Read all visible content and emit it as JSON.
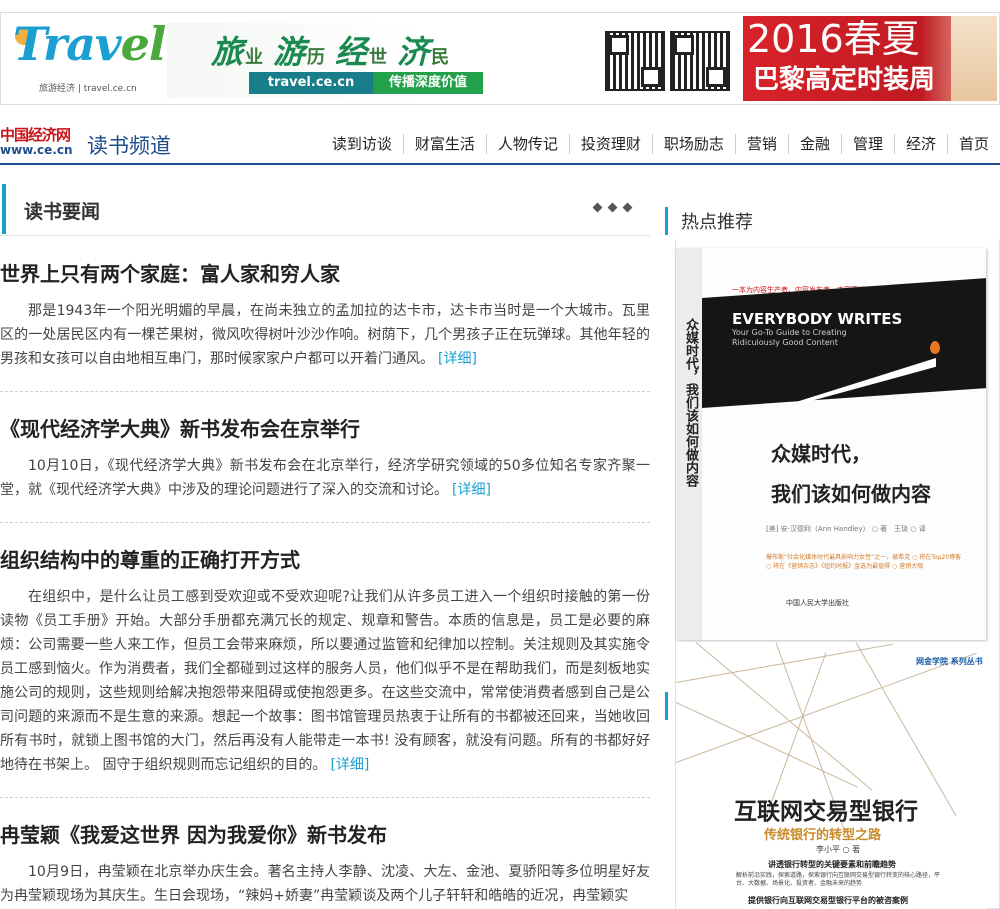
{
  "banner": {
    "logo_word_a": "Trav",
    "logo_word_b": "el",
    "logo_sub": "旅游经济 | travel.ce.cn",
    "slogan": [
      {
        "big": "旅",
        "small": "业"
      },
      {
        "big": "游",
        "small": "历"
      },
      {
        "big": "经",
        "small": "世"
      },
      {
        "big": "济",
        "small": "民"
      }
    ],
    "url": "travel.ce.cn",
    "tagline": "传播深度价值",
    "ad_line1": "2016春夏",
    "ad_line2": "巴黎高定时装周"
  },
  "channel": {
    "brand_cn_a": "中国",
    "brand_cn_b": "经济网",
    "brand_domain": "www.ce.cn",
    "name": "读书频道",
    "nav": [
      "读到访谈",
      "财富生活",
      "人物传记",
      "投资理财",
      "职场励志",
      "营销",
      "金融",
      "管理",
      "经济",
      "首页"
    ]
  },
  "section": {
    "title": "读书要闻"
  },
  "articles": [
    {
      "title": "世界上只有两个家庭：富人家和穷人家",
      "body": "那是1943年一个阳光明媚的早晨，在尚未独立的孟加拉的达卡市，达卡市当时是一个大城市。瓦里区的一处居民区内有一棵芒果树，微风吹得树叶沙沙作响。树荫下，几个男孩子正在玩弹球。其他年轻的男孩和女孩可以自由地相互串门，那时候家家户户都可以开着门通风。",
      "more": "[详细]"
    },
    {
      "title": "《现代经济学大典》新书发布会在京举行",
      "body": "10月10日，《现代经济学大典》新书发布会在北京举行，经济学研究领域的50多位知名专家齐聚一堂，就《现代经济学大典》中涉及的理论问题进行了深入的交流和讨论。",
      "more": "[详细]"
    },
    {
      "title": "组织结构中的尊重的正确打开方式",
      "body": "在组织中，是什么让员工感到受欢迎或不受欢迎呢?让我们从许多员工进入一个组织时接触的第一份读物《员工手册》开始。大部分手册都充满冗长的规定、规章和警告。本质的信息是，员工是必要的麻烦：公司需要一些人来工作，但员工会带来麻烦，所以要通过监管和纪律加以控制。关注规则及其实施令员工感到恼火。作为消费者，我们全都碰到过这样的服务人员，他们似乎不是在帮助我们，而是刻板地实施公司的规则，这些规则给解决抱怨带来阻碍或使抱怨更多。在这些交流中，常常使消费者感到自己是公司问题的来源而不是生意的来源。想起一个故事：图书馆管理员热衷于让所有的书都被还回来，当她收回所有书时，就锁上图书馆的大门，然后再没有人能带走一本书! 没有顾客，就没有问题。所有的书都好好地待在书架上。 固守于组织规则而忘记组织的目的。",
      "more": "[详细]"
    },
    {
      "title": "冉莹颖《我爱这世界 因为我爱你》新书发布",
      "body": "10月9日，冉莹颖在北京举办庆生会。著名主持人李静、沈凌、大左、金池、夏骄阳等多位明星好友为冉莹颖现场为其庆生。生日会现场，“辣妈+娇妻”冉莹颖谈及两个儿子轩轩和皓皓的近况，冉莹颖实",
      "more": ""
    }
  ],
  "sidebar": {
    "title": "热点推荐",
    "book1": {
      "top_line": "一本为内容生产者、内容发布者、内容营销者以及内容创业者量身定制的书",
      "english_title": "EVERYBODY WRITES",
      "english_subtitle": "Your Go-To Guide to Creating Ridiculously Good Content",
      "spine_title": "众媒时代，我们该如何做内容",
      "title_line1": "众媒时代，",
      "title_line2": "我们该如何做内容",
      "author": "[美] 安·汉德利（Ann Handley） ○ 著　王琰 ○ 译",
      "desc": "爆布斯“社会化媒体时代最具影响力女性”之一，被希克 ○ 将在Top20博客 ○ 将在《营销杂志》《纽约时报》金选为最值得 ○ 营销大咖",
      "publisher": "中国人民大学出版社"
    },
    "book2": {
      "series": "网金学院 系列丛书",
      "title": "互联网交易型银行",
      "subtitle": "传统银行的转型之路",
      "author": "李小平 ○ 著",
      "desc_head": "讲透银行转型的关键要素和前瞻趋势",
      "desc_body": "解析前沿实践，探索道路，探索银行向互联网交易型银行转变的核心路径，平台、大数据、场景化、投资者、金融未来的趋势",
      "desc_tail": "提供银行向互联网交易型银行平台的被咨案例"
    }
  },
  "colors": {
    "accent": "#1a9fd0",
    "channel_blue": "#1f4e8c",
    "ad_red": "#d8232a",
    "travel_green": "#1b8a50"
  }
}
